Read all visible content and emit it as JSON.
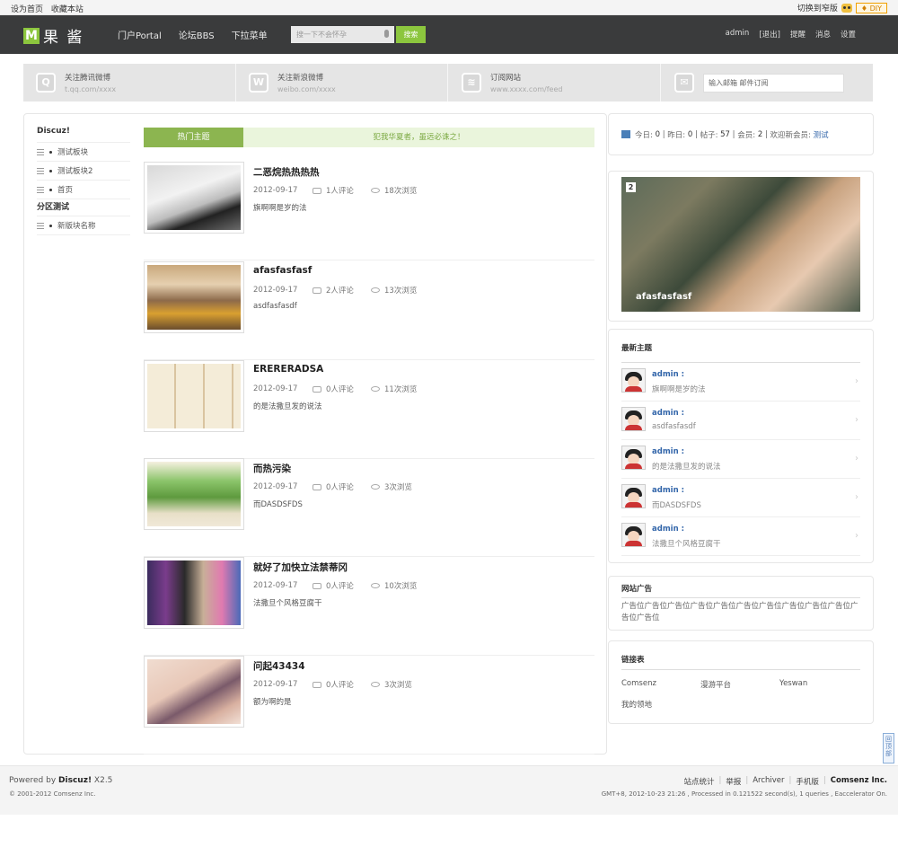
{
  "topbar": {
    "left": [
      "设为首页",
      "收藏本站"
    ],
    "switch": "切换到窄版",
    "diy": "♦ DIY"
  },
  "header": {
    "logo_text": "果 酱",
    "nav": [
      "门户Portal",
      "论坛BBS",
      "下拉菜单"
    ],
    "search_placeholder": "搜一下不会怀孕",
    "search_button": "搜索",
    "user": [
      "admin",
      "[退出]",
      "提醒",
      "消息",
      "设置"
    ]
  },
  "follow": [
    {
      "title": "关注腾讯微博",
      "sub": "t.qq.com/xxxx",
      "icon": "tencent-weibo-icon"
    },
    {
      "title": "关注新浪微博",
      "sub": "weibo.com/xxxx",
      "icon": "sina-weibo-icon"
    },
    {
      "title": "订阅网站",
      "sub": "www.xxxx.com/feed",
      "icon": "rss-icon"
    },
    {
      "input_placeholder": "输入邮箱 邮件订阅",
      "icon": "mail-icon"
    }
  ],
  "sidebar": {
    "section1": "Discuz!",
    "items1": [
      "测试板块",
      "测试板块2",
      "首页"
    ],
    "section2": "分区测试",
    "items2": [
      "新版块名称"
    ]
  },
  "hot": {
    "tab": "热门主题",
    "slogan": "犯我华夏者，虽远必诛之！"
  },
  "posts": [
    {
      "title": "二恶烷热热热热",
      "date": "2012-09-17",
      "comments": "1人评论",
      "views": "18次浏览",
      "excerpt": "旗啊啊是岁的法"
    },
    {
      "title": "afasfasfasf",
      "date": "2012-09-17",
      "comments": "2人评论",
      "views": "13次浏览",
      "excerpt": "asdfasfasdf"
    },
    {
      "title": "ERERERADSA",
      "date": "2012-09-17",
      "comments": "0人评论",
      "views": "11次浏览",
      "excerpt": "的是法撒旦发的说法"
    },
    {
      "title": "而热污染",
      "date": "2012-09-17",
      "comments": "0人评论",
      "views": "3次浏览",
      "excerpt": "而DASDSFDS"
    },
    {
      "title": "就好了加快立法禁蒂冈",
      "date": "2012-09-17",
      "comments": "0人评论",
      "views": "10次浏览",
      "excerpt": "法撒旦个风格豆腐干"
    },
    {
      "title": "问起43434",
      "date": "2012-09-17",
      "comments": "0人评论",
      "views": "3次浏览",
      "excerpt": "额为啊的是"
    }
  ],
  "stats": {
    "today_label": "今日:",
    "today": "0",
    "yesterday_label": "昨日:",
    "yesterday": "0",
    "posts_label": "帖子:",
    "posts": "57",
    "members_label": "会员:",
    "members": "2",
    "welcome_label": "欢迎新会员:",
    "new_member": "测试"
  },
  "photo": {
    "num": "2",
    "caption": "afasfasfasf"
  },
  "latest": {
    "title": "最新主题",
    "items": [
      {
        "user": "admin :",
        "text": "旗啊啊是岁的法"
      },
      {
        "user": "admin :",
        "text": "asdfasfasdf"
      },
      {
        "user": "admin :",
        "text": "的是法撒旦发的说法"
      },
      {
        "user": "admin :",
        "text": "而DASDSFDS"
      },
      {
        "user": "admin :",
        "text": "法撒旦个风格豆腐干"
      }
    ]
  },
  "ads": {
    "title": "网站广告",
    "content": "广告位广告位广告位广告位广告位广告位广告位广告位广告位广告位广告位广告位"
  },
  "links": {
    "title": "链接表",
    "items": [
      "Comsenz",
      "漫游平台",
      "Yeswan",
      "我的领地"
    ]
  },
  "totop": "回顶部",
  "footer": {
    "powered": "Powered by",
    "brand": "Discuz!",
    "version": "X2.5",
    "copyright": "© 2001-2012 Comsenz Inc.",
    "links": [
      "站点统计",
      "举报",
      "Archiver",
      "手机版",
      "Comsenz Inc."
    ],
    "gmt": "GMT+8, 2012-10-23 21:26 , Processed in 0.121522 second(s), 1 queries , Eaccelerator On."
  }
}
